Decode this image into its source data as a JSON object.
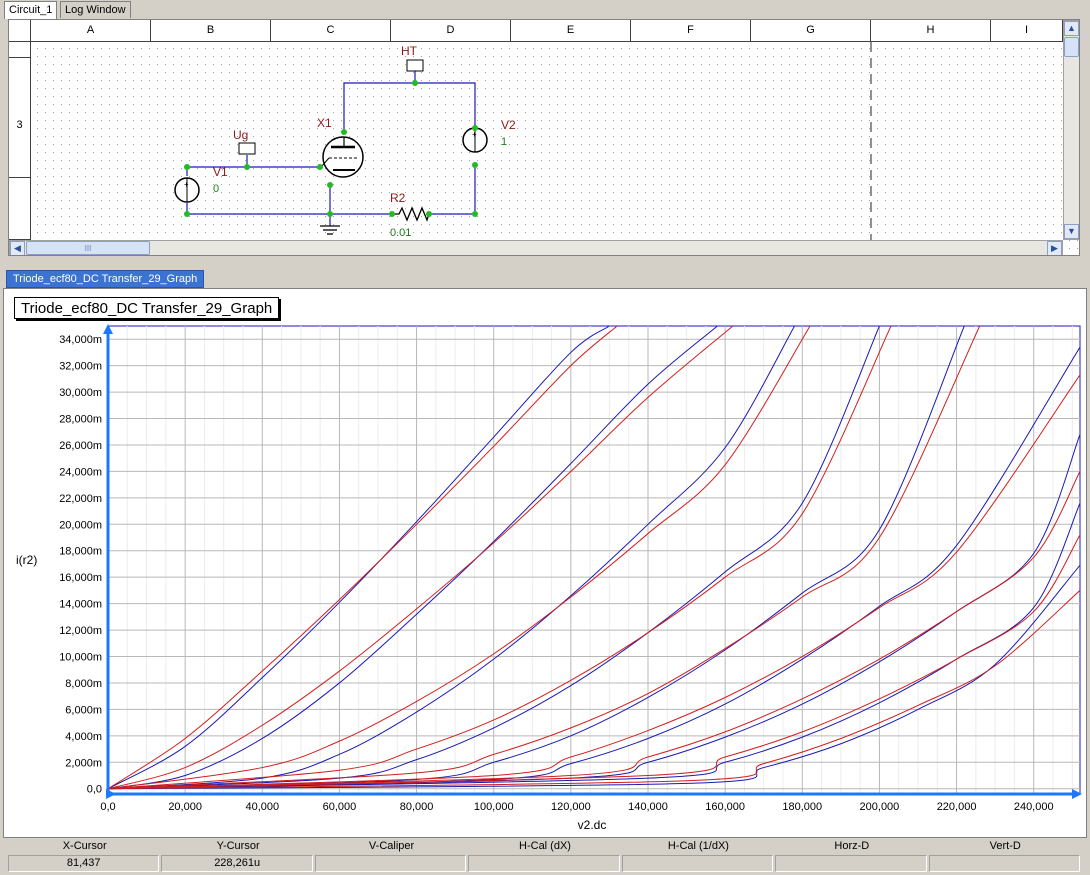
{
  "tabs": [
    "Circuit_1",
    "Log Window"
  ],
  "schematic": {
    "columns": [
      "A",
      "B",
      "C",
      "D",
      "E",
      "F",
      "G",
      "H",
      "I"
    ],
    "row_label": "3",
    "components": {
      "ht_label": "HT",
      "ug_label": "Ug",
      "x1_label": "X1",
      "v1_label": "V1",
      "v1_value": "0",
      "v2_label": "V2",
      "v2_value": "1",
      "r2_label": "R2",
      "r2_value": "0.01"
    },
    "scroll_glyph": "III"
  },
  "graph": {
    "tab_label": "Triode_ecf80_DC Transfer_29_Graph",
    "title": "Triode_ecf80_DC Transfer_29_Graph"
  },
  "chart_data": {
    "type": "line",
    "title": "Triode_ecf80_DC Transfer_29_Graph",
    "xlabel": "v2.dc",
    "ylabel": "i(r2)",
    "xlim": [
      0,
      252
    ],
    "ylim": [
      -0.4,
      35
    ],
    "x_ticks": [
      "0,0",
      "20,000",
      "40,000",
      "60,000",
      "80,000",
      "100,000",
      "120,000",
      "140,000",
      "160,000",
      "180,000",
      "200,000",
      "220,000",
      "240,000"
    ],
    "y_ticks": [
      "0,0",
      "2,000m",
      "4,000m",
      "6,000m",
      "8,000m",
      "10,000m",
      "12,000m",
      "14,000m",
      "16,000m",
      "18,000m",
      "20,000m",
      "22,000m",
      "24,000m",
      "26,000m",
      "28,000m",
      "30,000m",
      "32,000m",
      "34,000m"
    ],
    "grid": true,
    "series_colors": {
      "blue": "#1a1ab4",
      "red": "#d21e1e"
    },
    "series": [
      {
        "color": "blue",
        "x": [
          0,
          20,
          40,
          60,
          80,
          100,
          120,
          130
        ],
        "y": [
          0,
          3.2,
          8.4,
          14.1,
          20.2,
          26.6,
          33.0,
          35
        ]
      },
      {
        "color": "red",
        "x": [
          0,
          20,
          40,
          60,
          80,
          100,
          120,
          132
        ],
        "y": [
          0,
          3.8,
          8.9,
          14.3,
          20.0,
          25.9,
          32.0,
          35
        ]
      },
      {
        "color": "blue",
        "x": [
          0,
          20,
          40,
          60,
          80,
          100,
          120,
          140,
          158
        ],
        "y": [
          0,
          1.0,
          3.8,
          8.0,
          13.2,
          18.7,
          24.6,
          30.6,
          35
        ]
      },
      {
        "color": "red",
        "x": [
          0,
          20,
          40,
          60,
          80,
          100,
          120,
          140,
          162
        ],
        "y": [
          0,
          1.6,
          4.8,
          8.9,
          13.6,
          18.6,
          24.0,
          29.6,
          35
        ]
      },
      {
        "color": "blue",
        "x": [
          0,
          40,
          60,
          80,
          100,
          120,
          140,
          160,
          178
        ],
        "y": [
          0,
          0.8,
          2.6,
          5.8,
          9.8,
          14.6,
          20.0,
          25.8,
          35
        ]
      },
      {
        "color": "red",
        "x": [
          0,
          40,
          60,
          80,
          100,
          120,
          140,
          160,
          182
        ],
        "y": [
          0,
          1.6,
          3.6,
          6.6,
          10.2,
          14.5,
          19.3,
          24.5,
          35
        ]
      },
      {
        "color": "blue",
        "x": [
          0,
          60,
          80,
          100,
          120,
          140,
          160,
          180,
          200
        ],
        "y": [
          0,
          0.8,
          2.2,
          4.6,
          7.8,
          11.8,
          16.4,
          21.6,
          35
        ]
      },
      {
        "color": "red",
        "x": [
          0,
          60,
          80,
          100,
          120,
          140,
          160,
          180,
          203
        ],
        "y": [
          0,
          1.4,
          3.0,
          5.2,
          8.2,
          11.8,
          16.0,
          20.8,
          35
        ]
      },
      {
        "color": "blue",
        "x": [
          0,
          80,
          100,
          120,
          140,
          160,
          180,
          200,
          222
        ],
        "y": [
          0,
          0.7,
          2.0,
          4.0,
          6.9,
          10.5,
          14.8,
          19.6,
          35
        ]
      },
      {
        "color": "red",
        "x": [
          0,
          80,
          100,
          120,
          140,
          160,
          180,
          200,
          226
        ],
        "y": [
          0,
          1.2,
          2.6,
          4.6,
          7.2,
          10.6,
          14.5,
          19.0,
          35
        ]
      },
      {
        "color": "blue",
        "x": [
          0,
          100,
          120,
          140,
          160,
          180,
          200,
          220,
          252
        ],
        "y": [
          0,
          0.7,
          1.9,
          3.8,
          6.4,
          9.8,
          13.8,
          18.4,
          33.4
        ]
      },
      {
        "color": "red",
        "x": [
          0,
          100,
          120,
          140,
          160,
          180,
          200,
          220,
          252
        ],
        "y": [
          0,
          1.0,
          2.4,
          4.4,
          6.9,
          10.0,
          13.7,
          17.9,
          31.3
        ]
      },
      {
        "color": "blue",
        "x": [
          0,
          120,
          140,
          160,
          180,
          200,
          220,
          240,
          252
        ],
        "y": [
          0,
          0.8,
          2.0,
          3.9,
          6.4,
          9.6,
          13.4,
          17.8,
          26.8
        ]
      },
      {
        "color": "red",
        "x": [
          0,
          120,
          140,
          160,
          180,
          200,
          220,
          240,
          252
        ],
        "y": [
          0,
          1.0,
          2.4,
          4.3,
          6.8,
          9.8,
          13.4,
          17.5,
          24.0
        ]
      },
      {
        "color": "blue",
        "x": [
          0,
          140,
          160,
          180,
          200,
          220,
          240,
          252
        ],
        "y": [
          0,
          0.8,
          2.0,
          3.9,
          6.5,
          9.8,
          13.7,
          21.6
        ]
      },
      {
        "color": "red",
        "x": [
          0,
          140,
          160,
          180,
          200,
          220,
          240,
          252
        ],
        "y": [
          0,
          1.0,
          2.4,
          4.3,
          6.8,
          9.8,
          13.4,
          19.2
        ]
      },
      {
        "color": "blue",
        "x": [
          0,
          150,
          170,
          190,
          210,
          230,
          252
        ],
        "y": [
          0,
          0.4,
          1.6,
          3.4,
          6.0,
          9.4,
          16.9
        ]
      },
      {
        "color": "red",
        "x": [
          0,
          150,
          170,
          190,
          210,
          230,
          252
        ],
        "y": [
          0,
          0.6,
          1.9,
          3.8,
          6.3,
          9.3,
          15.0
        ]
      }
    ]
  },
  "status": {
    "headers": [
      "X-Cursor",
      "Y-Cursor",
      "V-Caliper",
      "H-Cal (dX)",
      "H-Cal (1/dX)",
      "Horz-D",
      "Vert-D"
    ],
    "values": [
      "81,437",
      "228,261u",
      "",
      "",
      "",
      "",
      ""
    ]
  }
}
